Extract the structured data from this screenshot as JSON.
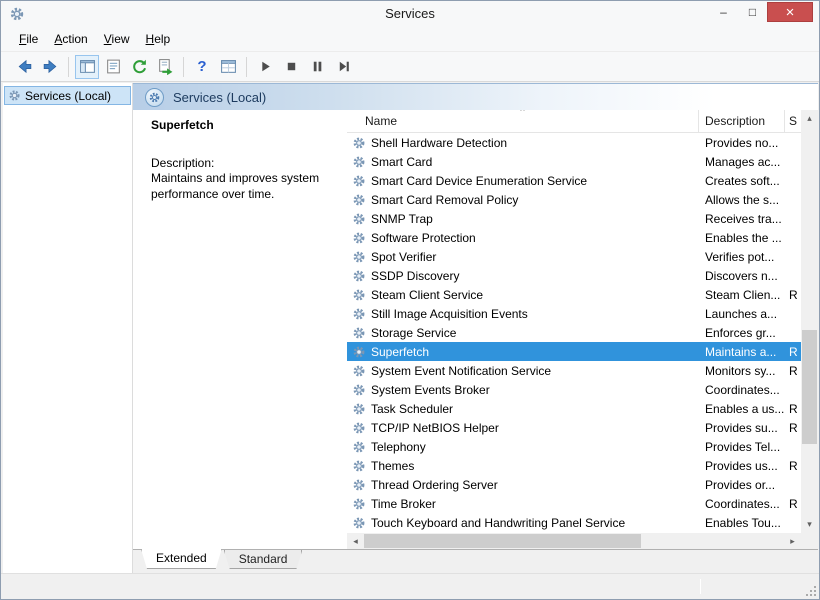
{
  "window": {
    "title": "Services",
    "controls": {
      "minimize": "–",
      "maximize": "□",
      "close": "×"
    }
  },
  "menu": {
    "items": [
      "File",
      "Action",
      "View",
      "Help"
    ]
  },
  "toolbar": {
    "buttons": [
      "back",
      "forward",
      "show-hide-console-tree",
      "properties",
      "refresh",
      "export-list",
      "help",
      "view",
      "start-service",
      "stop-service",
      "pause-service",
      "restart-service"
    ],
    "help_glyph": "?"
  },
  "tree": {
    "root_label": "Services (Local)"
  },
  "header": {
    "title": "Services (Local)"
  },
  "detail": {
    "service_name": "Superfetch",
    "description_label": "Description:",
    "description_text": "Maintains and improves system performance over time."
  },
  "list": {
    "columns": {
      "name": "Name",
      "description": "Description",
      "status": "S"
    },
    "rows": [
      {
        "name": "Shell Hardware Detection",
        "description": "Provides no...",
        "status": ""
      },
      {
        "name": "Smart Card",
        "description": "Manages ac...",
        "status": ""
      },
      {
        "name": "Smart Card Device Enumeration Service",
        "description": "Creates soft...",
        "status": ""
      },
      {
        "name": "Smart Card Removal Policy",
        "description": "Allows the s...",
        "status": ""
      },
      {
        "name": "SNMP Trap",
        "description": "Receives tra...",
        "status": ""
      },
      {
        "name": "Software Protection",
        "description": "Enables the ...",
        "status": ""
      },
      {
        "name": "Spot Verifier",
        "description": "Verifies pot...",
        "status": ""
      },
      {
        "name": "SSDP Discovery",
        "description": "Discovers n...",
        "status": ""
      },
      {
        "name": "Steam Client Service",
        "description": "Steam Clien...",
        "status": "R"
      },
      {
        "name": "Still Image Acquisition Events",
        "description": "Launches a...",
        "status": ""
      },
      {
        "name": "Storage Service",
        "description": "Enforces gr...",
        "status": ""
      },
      {
        "name": "Superfetch",
        "description": "Maintains a...",
        "status": "R",
        "selected": true
      },
      {
        "name": "System Event Notification Service",
        "description": "Monitors sy...",
        "status": "R"
      },
      {
        "name": "System Events Broker",
        "description": "Coordinates...",
        "status": ""
      },
      {
        "name": "Task Scheduler",
        "description": "Enables a us...",
        "status": "R"
      },
      {
        "name": "TCP/IP NetBIOS Helper",
        "description": "Provides su...",
        "status": "R"
      },
      {
        "name": "Telephony",
        "description": "Provides Tel...",
        "status": ""
      },
      {
        "name": "Themes",
        "description": "Provides us...",
        "status": "R"
      },
      {
        "name": "Thread Ordering Server",
        "description": "Provides or...",
        "status": ""
      },
      {
        "name": "Time Broker",
        "description": "Coordinates...",
        "status": "R"
      },
      {
        "name": "Touch Keyboard and Handwriting Panel Service",
        "description": "Enables Tou...",
        "status": ""
      }
    ]
  },
  "tabs": {
    "items": [
      "Extended",
      "Standard"
    ],
    "active": "Extended"
  },
  "icons": {
    "app": "gear-icon",
    "service": "gear-icon",
    "sort_ascending": "ˆ",
    "scroll_up": "▴",
    "scroll_down": "▾",
    "scroll_left": "◂",
    "scroll_right": "▸"
  },
  "colors": {
    "selection_blue": "#3093dc",
    "close_button_red": "#c94f4f",
    "header_band_blue": "#b7cee7",
    "tree_selection": "#cde4f7"
  }
}
